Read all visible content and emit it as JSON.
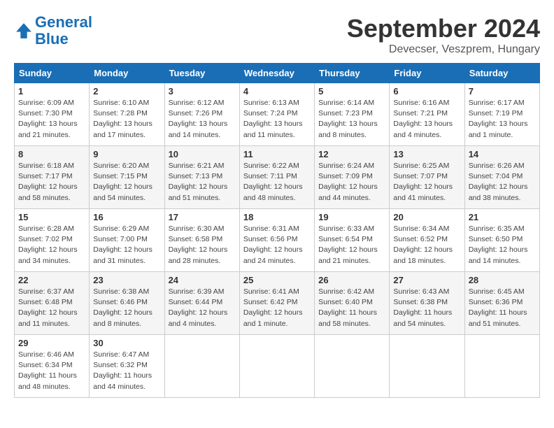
{
  "header": {
    "logo_line1": "General",
    "logo_line2": "Blue",
    "month_title": "September 2024",
    "subtitle": "Devecser, Veszprem, Hungary"
  },
  "days_of_week": [
    "Sunday",
    "Monday",
    "Tuesday",
    "Wednesday",
    "Thursday",
    "Friday",
    "Saturday"
  ],
  "weeks": [
    [
      {
        "day": "1",
        "detail": "Sunrise: 6:09 AM\nSunset: 7:30 PM\nDaylight: 13 hours\nand 21 minutes."
      },
      {
        "day": "2",
        "detail": "Sunrise: 6:10 AM\nSunset: 7:28 PM\nDaylight: 13 hours\nand 17 minutes."
      },
      {
        "day": "3",
        "detail": "Sunrise: 6:12 AM\nSunset: 7:26 PM\nDaylight: 13 hours\nand 14 minutes."
      },
      {
        "day": "4",
        "detail": "Sunrise: 6:13 AM\nSunset: 7:24 PM\nDaylight: 13 hours\nand 11 minutes."
      },
      {
        "day": "5",
        "detail": "Sunrise: 6:14 AM\nSunset: 7:23 PM\nDaylight: 13 hours\nand 8 minutes."
      },
      {
        "day": "6",
        "detail": "Sunrise: 6:16 AM\nSunset: 7:21 PM\nDaylight: 13 hours\nand 4 minutes."
      },
      {
        "day": "7",
        "detail": "Sunrise: 6:17 AM\nSunset: 7:19 PM\nDaylight: 13 hours\nand 1 minute."
      }
    ],
    [
      {
        "day": "8",
        "detail": "Sunrise: 6:18 AM\nSunset: 7:17 PM\nDaylight: 12 hours\nand 58 minutes."
      },
      {
        "day": "9",
        "detail": "Sunrise: 6:20 AM\nSunset: 7:15 PM\nDaylight: 12 hours\nand 54 minutes."
      },
      {
        "day": "10",
        "detail": "Sunrise: 6:21 AM\nSunset: 7:13 PM\nDaylight: 12 hours\nand 51 minutes."
      },
      {
        "day": "11",
        "detail": "Sunrise: 6:22 AM\nSunset: 7:11 PM\nDaylight: 12 hours\nand 48 minutes."
      },
      {
        "day": "12",
        "detail": "Sunrise: 6:24 AM\nSunset: 7:09 PM\nDaylight: 12 hours\nand 44 minutes."
      },
      {
        "day": "13",
        "detail": "Sunrise: 6:25 AM\nSunset: 7:07 PM\nDaylight: 12 hours\nand 41 minutes."
      },
      {
        "day": "14",
        "detail": "Sunrise: 6:26 AM\nSunset: 7:04 PM\nDaylight: 12 hours\nand 38 minutes."
      }
    ],
    [
      {
        "day": "15",
        "detail": "Sunrise: 6:28 AM\nSunset: 7:02 PM\nDaylight: 12 hours\nand 34 minutes."
      },
      {
        "day": "16",
        "detail": "Sunrise: 6:29 AM\nSunset: 7:00 PM\nDaylight: 12 hours\nand 31 minutes."
      },
      {
        "day": "17",
        "detail": "Sunrise: 6:30 AM\nSunset: 6:58 PM\nDaylight: 12 hours\nand 28 minutes."
      },
      {
        "day": "18",
        "detail": "Sunrise: 6:31 AM\nSunset: 6:56 PM\nDaylight: 12 hours\nand 24 minutes."
      },
      {
        "day": "19",
        "detail": "Sunrise: 6:33 AM\nSunset: 6:54 PM\nDaylight: 12 hours\nand 21 minutes."
      },
      {
        "day": "20",
        "detail": "Sunrise: 6:34 AM\nSunset: 6:52 PM\nDaylight: 12 hours\nand 18 minutes."
      },
      {
        "day": "21",
        "detail": "Sunrise: 6:35 AM\nSunset: 6:50 PM\nDaylight: 12 hours\nand 14 minutes."
      }
    ],
    [
      {
        "day": "22",
        "detail": "Sunrise: 6:37 AM\nSunset: 6:48 PM\nDaylight: 12 hours\nand 11 minutes."
      },
      {
        "day": "23",
        "detail": "Sunrise: 6:38 AM\nSunset: 6:46 PM\nDaylight: 12 hours\nand 8 minutes."
      },
      {
        "day": "24",
        "detail": "Sunrise: 6:39 AM\nSunset: 6:44 PM\nDaylight: 12 hours\nand 4 minutes."
      },
      {
        "day": "25",
        "detail": "Sunrise: 6:41 AM\nSunset: 6:42 PM\nDaylight: 12 hours\nand 1 minute."
      },
      {
        "day": "26",
        "detail": "Sunrise: 6:42 AM\nSunset: 6:40 PM\nDaylight: 11 hours\nand 58 minutes."
      },
      {
        "day": "27",
        "detail": "Sunrise: 6:43 AM\nSunset: 6:38 PM\nDaylight: 11 hours\nand 54 minutes."
      },
      {
        "day": "28",
        "detail": "Sunrise: 6:45 AM\nSunset: 6:36 PM\nDaylight: 11 hours\nand 51 minutes."
      }
    ],
    [
      {
        "day": "29",
        "detail": "Sunrise: 6:46 AM\nSunset: 6:34 PM\nDaylight: 11 hours\nand 48 minutes."
      },
      {
        "day": "30",
        "detail": "Sunrise: 6:47 AM\nSunset: 6:32 PM\nDaylight: 11 hours\nand 44 minutes."
      },
      {
        "day": "",
        "detail": ""
      },
      {
        "day": "",
        "detail": ""
      },
      {
        "day": "",
        "detail": ""
      },
      {
        "day": "",
        "detail": ""
      },
      {
        "day": "",
        "detail": ""
      }
    ]
  ]
}
